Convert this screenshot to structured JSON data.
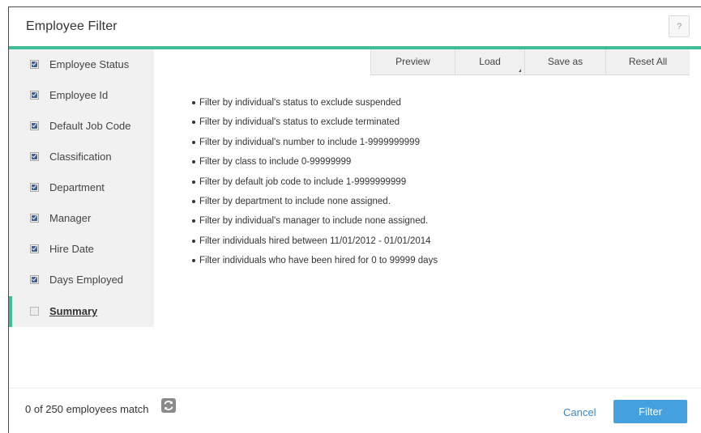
{
  "dialog": {
    "title": "Employee Filter",
    "help_label": "?"
  },
  "sidebar": {
    "items": [
      {
        "label": "Employee Status",
        "checked": true
      },
      {
        "label": "Employee Id",
        "checked": true
      },
      {
        "label": "Default Job Code",
        "checked": true
      },
      {
        "label": "Classification",
        "checked": true
      },
      {
        "label": "Department",
        "checked": true
      },
      {
        "label": "Manager",
        "checked": true
      },
      {
        "label": "Hire Date",
        "checked": true
      },
      {
        "label": "Days Employed",
        "checked": true
      },
      {
        "label": "Summary",
        "checked": false,
        "active": true
      }
    ]
  },
  "toolbar": {
    "preview": "Preview",
    "load": "Load",
    "save_as": "Save as",
    "reset_all": "Reset All"
  },
  "summary": {
    "items": [
      "Filter by individual's status to exclude suspended",
      "Filter by individual's status to exclude terminated",
      "Filter by individual's number to include 1-9999999999",
      "Filter by class to include 0-99999999",
      "Filter by default job code to include 1-9999999999",
      "Filter by department to include none assigned.",
      "Filter by individual's manager to include none assigned.",
      "Filter individuals hired between 11/01/2012 - 01/01/2014",
      "Filter individuals who have been hired for 0 to 99999 days"
    ]
  },
  "footer": {
    "match_text": "0 of 250 employees match",
    "cancel": "Cancel",
    "filter": "Filter"
  },
  "colors": {
    "accent": "#3dbd98",
    "primary_button": "#45a0df",
    "link": "#3b86c8"
  },
  "icons": {
    "refresh": "refresh-icon",
    "help": "help-icon",
    "load_caret": "dropdown-caret-icon"
  }
}
